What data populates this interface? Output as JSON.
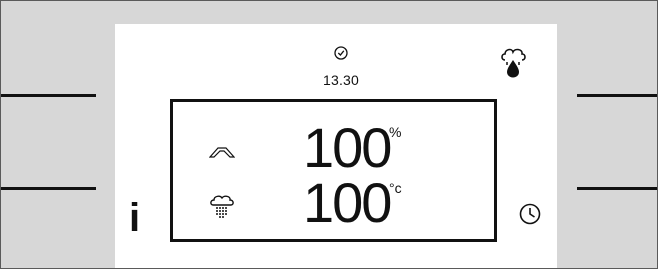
{
  "display": {
    "time": "13.30",
    "icons": {
      "top_clock": "clock-icon",
      "top_right": "steam-tap-icon",
      "info": "info-icon",
      "timer": "timer-icon",
      "humidity": "up-chevron-icon",
      "steam": "steam-icon"
    },
    "humidity_value": "100",
    "humidity_unit": "%",
    "temperature_value": "100",
    "temperature_unit": "°c",
    "info_label": "i"
  },
  "colors": {
    "panel": "#d7d7d7",
    "screen": "#ffffff",
    "ink": "#111111"
  }
}
